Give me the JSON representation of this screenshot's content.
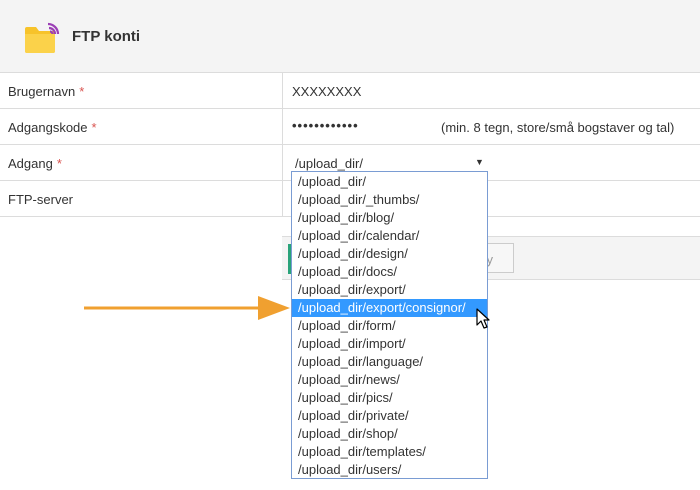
{
  "header": {
    "title": "FTP konti",
    "icon": "folder-icon"
  },
  "form": {
    "username": {
      "label": "Brugernavn",
      "required_mark": "*",
      "value": "XXXXXXXX"
    },
    "password": {
      "label": "Adgangskode",
      "required_mark": "*",
      "value": "••••••••••••",
      "hint": "(min. 8 tegn, store/små bogstaver og tal)"
    },
    "access": {
      "label": "Adgang",
      "required_mark": "*",
      "selected": "/upload_dir/"
    },
    "ftp_server": {
      "label": "FTP-server"
    }
  },
  "buttons": {
    "cancel_visible_text": "y"
  },
  "dropdown": {
    "options": [
      "/upload_dir/",
      "/upload_dir/_thumbs/",
      "/upload_dir/blog/",
      "/upload_dir/calendar/",
      "/upload_dir/design/",
      "/upload_dir/docs/",
      "/upload_dir/export/",
      "/upload_dir/export/consignor/",
      "/upload_dir/form/",
      "/upload_dir/import/",
      "/upload_dir/language/",
      "/upload_dir/news/",
      "/upload_dir/pics/",
      "/upload_dir/private/",
      "/upload_dir/shop/",
      "/upload_dir/templates/",
      "/upload_dir/users/"
    ],
    "highlighted": "/upload_dir/export/consignor/"
  },
  "colors": {
    "accent": "#3399ff",
    "arrow": "#f0a030",
    "required": "#d9534f",
    "folder": "#f7c32a",
    "save": "#2aa37a"
  }
}
